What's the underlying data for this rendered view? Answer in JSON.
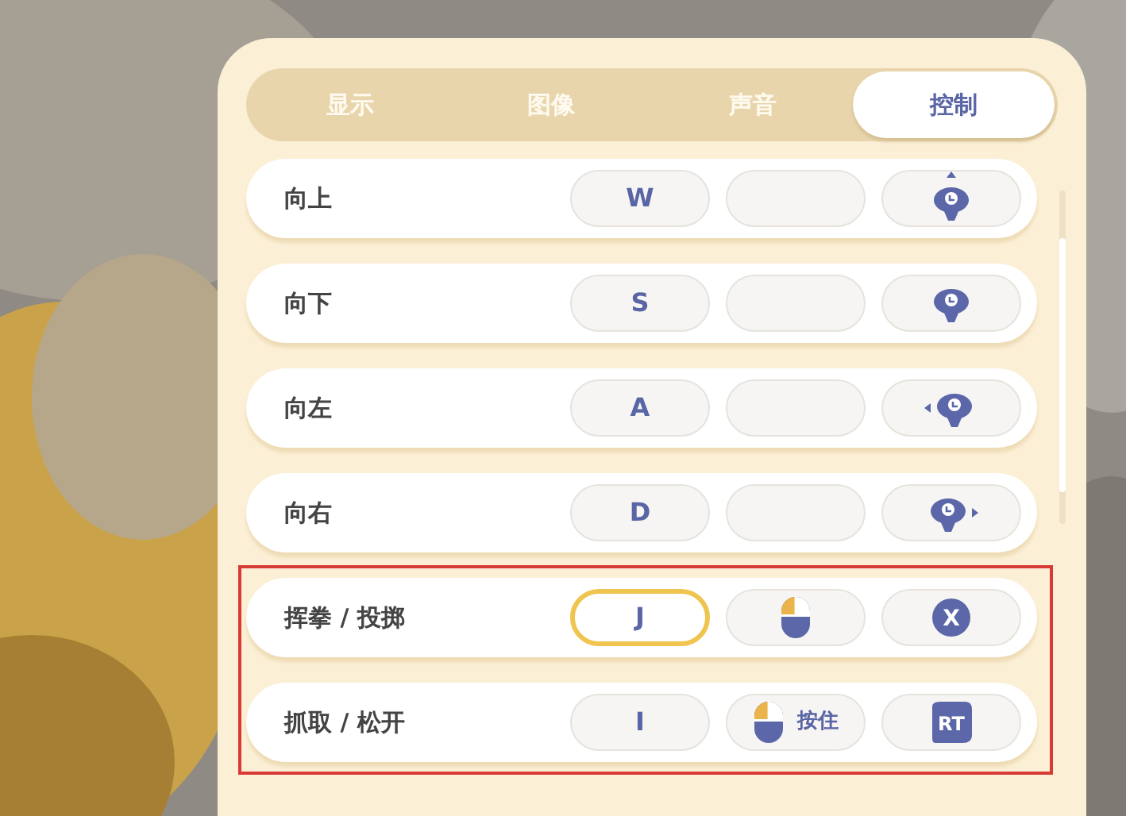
{
  "tabs": [
    {
      "label": "显示",
      "selected": false
    },
    {
      "label": "图像",
      "selected": false
    },
    {
      "label": "声音",
      "selected": false
    },
    {
      "label": "控制",
      "selected": true
    }
  ],
  "controls": [
    {
      "action": "向上",
      "highlighted": false,
      "bindings": [
        {
          "kind": "key",
          "label": "W",
          "focused": false
        },
        {
          "kind": "empty",
          "focused": false
        },
        {
          "kind": "stick_up",
          "focused": false
        }
      ]
    },
    {
      "action": "向下",
      "highlighted": false,
      "bindings": [
        {
          "kind": "key",
          "label": "S",
          "focused": false
        },
        {
          "kind": "empty",
          "focused": false
        },
        {
          "kind": "stick_down",
          "focused": false
        }
      ]
    },
    {
      "action": "向左",
      "highlighted": false,
      "bindings": [
        {
          "kind": "key",
          "label": "A",
          "focused": false
        },
        {
          "kind": "empty",
          "focused": false
        },
        {
          "kind": "stick_left",
          "focused": false
        }
      ]
    },
    {
      "action": "向右",
      "highlighted": false,
      "bindings": [
        {
          "kind": "key",
          "label": "D",
          "focused": false
        },
        {
          "kind": "empty",
          "focused": false
        },
        {
          "kind": "stick_right",
          "focused": false
        }
      ]
    },
    {
      "action": "挥拳 / 投掷",
      "highlighted": true,
      "bindings": [
        {
          "kind": "key",
          "label": "J",
          "focused": true
        },
        {
          "kind": "mouse",
          "focused": false
        },
        {
          "kind": "face_button",
          "label": "X",
          "focused": false
        }
      ]
    },
    {
      "action": "抓取 / 松开",
      "highlighted": true,
      "bindings": [
        {
          "kind": "key",
          "label": "I",
          "focused": false
        },
        {
          "kind": "mouse",
          "label": "按住",
          "focused": false
        },
        {
          "kind": "trigger",
          "label": "RT",
          "focused": false
        }
      ]
    }
  ]
}
